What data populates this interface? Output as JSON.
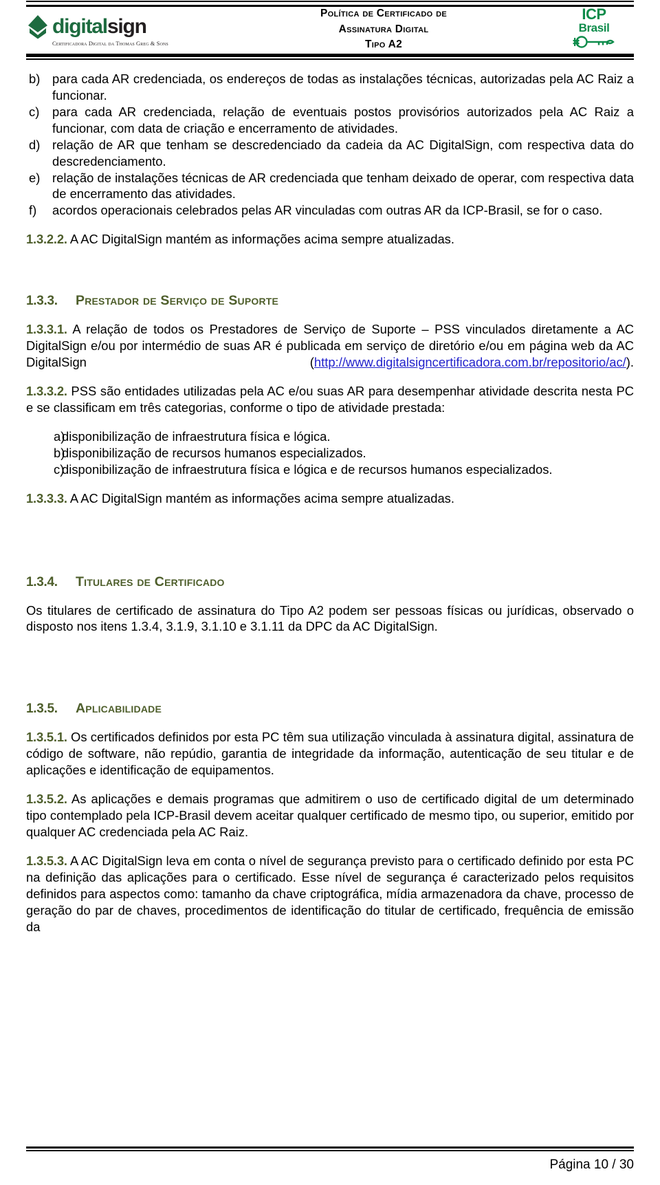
{
  "header": {
    "logo": {
      "brand_part1": "digital",
      "brand_part2": "sign",
      "tagline": "Certificadora Digital da Thomas Greg & Sons",
      "mark_icon": "shield-chevron-icon"
    },
    "title_line1": "Política de Certificado de",
    "title_line2": "Assinatura Digital",
    "title_line3": "Tipo A2",
    "icp": {
      "line1": "ICP",
      "line2": "Brasil",
      "icon": "key-icon",
      "color": "#0e8c4b"
    }
  },
  "colors": {
    "heading": "#4e5e2b",
    "link": "#2222cc",
    "brand_green": "#1d6b3f"
  },
  "content": {
    "list1": [
      {
        "mark": "b)",
        "text": "para cada AR credenciada, os endereços de todas as instalações técnicas, autorizadas pela AC Raiz a funcionar."
      },
      {
        "mark": "c)",
        "text": "para cada AR credenciada, relação de eventuais postos provisórios autorizados pela AC Raiz a funcionar, com data de criação e encerramento de atividades."
      },
      {
        "mark": "d)",
        "text": "relação de AR que tenham se descredenciado da cadeia da AC DigitalSign, com respectiva data do descredenciamento."
      },
      {
        "mark": "e)",
        "text": "relação de instalações técnicas de AR credenciada que tenham deixado de operar, com respectiva data de encerramento das atividades."
      },
      {
        "mark": "f)",
        "text": "acordos operacionais celebrados pelas AR vinculadas com outras AR da ICP-Brasil, se for o caso."
      }
    ],
    "p_1322": {
      "num": "1.3.2.2.",
      "text": " A AC DigitalSign mantém as informações acima sempre atualizadas."
    },
    "h_133": {
      "num": "1.3.3.",
      "title": "Prestador de Serviço de Suporte"
    },
    "p_1331": {
      "num": "1.3.3.1.",
      "text_before": " A relação de todos os Prestadores de Serviço de Suporte – PSS vinculados diretamente a AC DigitalSign e/ou por intermédio de suas AR é publicada em serviço de diretório e/ou em página web da AC DigitalSign (",
      "url": "http://www.digitalsigncertificadora.com.br/repositorio/ac/",
      "text_after": ")."
    },
    "p_1332": {
      "num": "1.3.3.2.",
      "text": " PSS são entidades utilizadas pela AC e/ou suas AR para desempenhar atividade descrita nesta PC e se classificam em três categorias, conforme o tipo de atividade prestada:"
    },
    "list2": [
      {
        "mark": "a)",
        "text": "disponibilização de infraestrutura física e lógica."
      },
      {
        "mark": "b)",
        "text": "disponibilização de recursos humanos especializados."
      },
      {
        "mark": "c)",
        "text": "disponibilização de infraestrutura física e lógica e de recursos humanos especializados."
      }
    ],
    "p_1333": {
      "num": "1.3.3.3.",
      "text": " A AC DigitalSign mantém as informações acima sempre atualizadas."
    },
    "h_134": {
      "num": "1.3.4.",
      "title": "Titulares de Certificado"
    },
    "p_134": {
      "text": "Os titulares de certificado de assinatura do Tipo A2 podem ser pessoas físicas ou jurídicas, observado o disposto nos itens 1.3.4, 3.1.9, 3.1.10 e 3.1.11 da DPC da AC DigitalSign."
    },
    "h_135": {
      "num": "1.3.5.",
      "title": "Aplicabilidade"
    },
    "p_1351": {
      "num": "1.3.5.1.",
      "text": " Os certificados definidos por esta PC têm sua utilização vinculada à assinatura digital, assinatura de código de software, não repúdio, garantia de integridade da informação, autenticação de seu titular e de aplicações e identificação de equipamentos."
    },
    "p_1352": {
      "num": "1.3.5.2.",
      "text": " As aplicações e demais programas que admitirem o uso de certificado digital de um determinado tipo contemplado pela ICP-Brasil devem aceitar qualquer certificado de mesmo tipo, ou superior, emitido por qualquer AC credenciada pela AC Raiz."
    },
    "p_1353": {
      "num": "1.3.5.3.",
      "text": " A AC DigitalSign leva em conta o nível de segurança previsto para o certificado definido por esta PC na definição das aplicações para o certificado. Esse nível de segurança é caracterizado pelos requisitos definidos para aspectos como: tamanho da chave criptográfica, mídia armazenadora da chave, processo de geração do par de chaves, procedimentos de identificação do titular de certificado, frequência de emissão da"
    }
  },
  "footer": {
    "page_label": "Página 10 / 30"
  }
}
